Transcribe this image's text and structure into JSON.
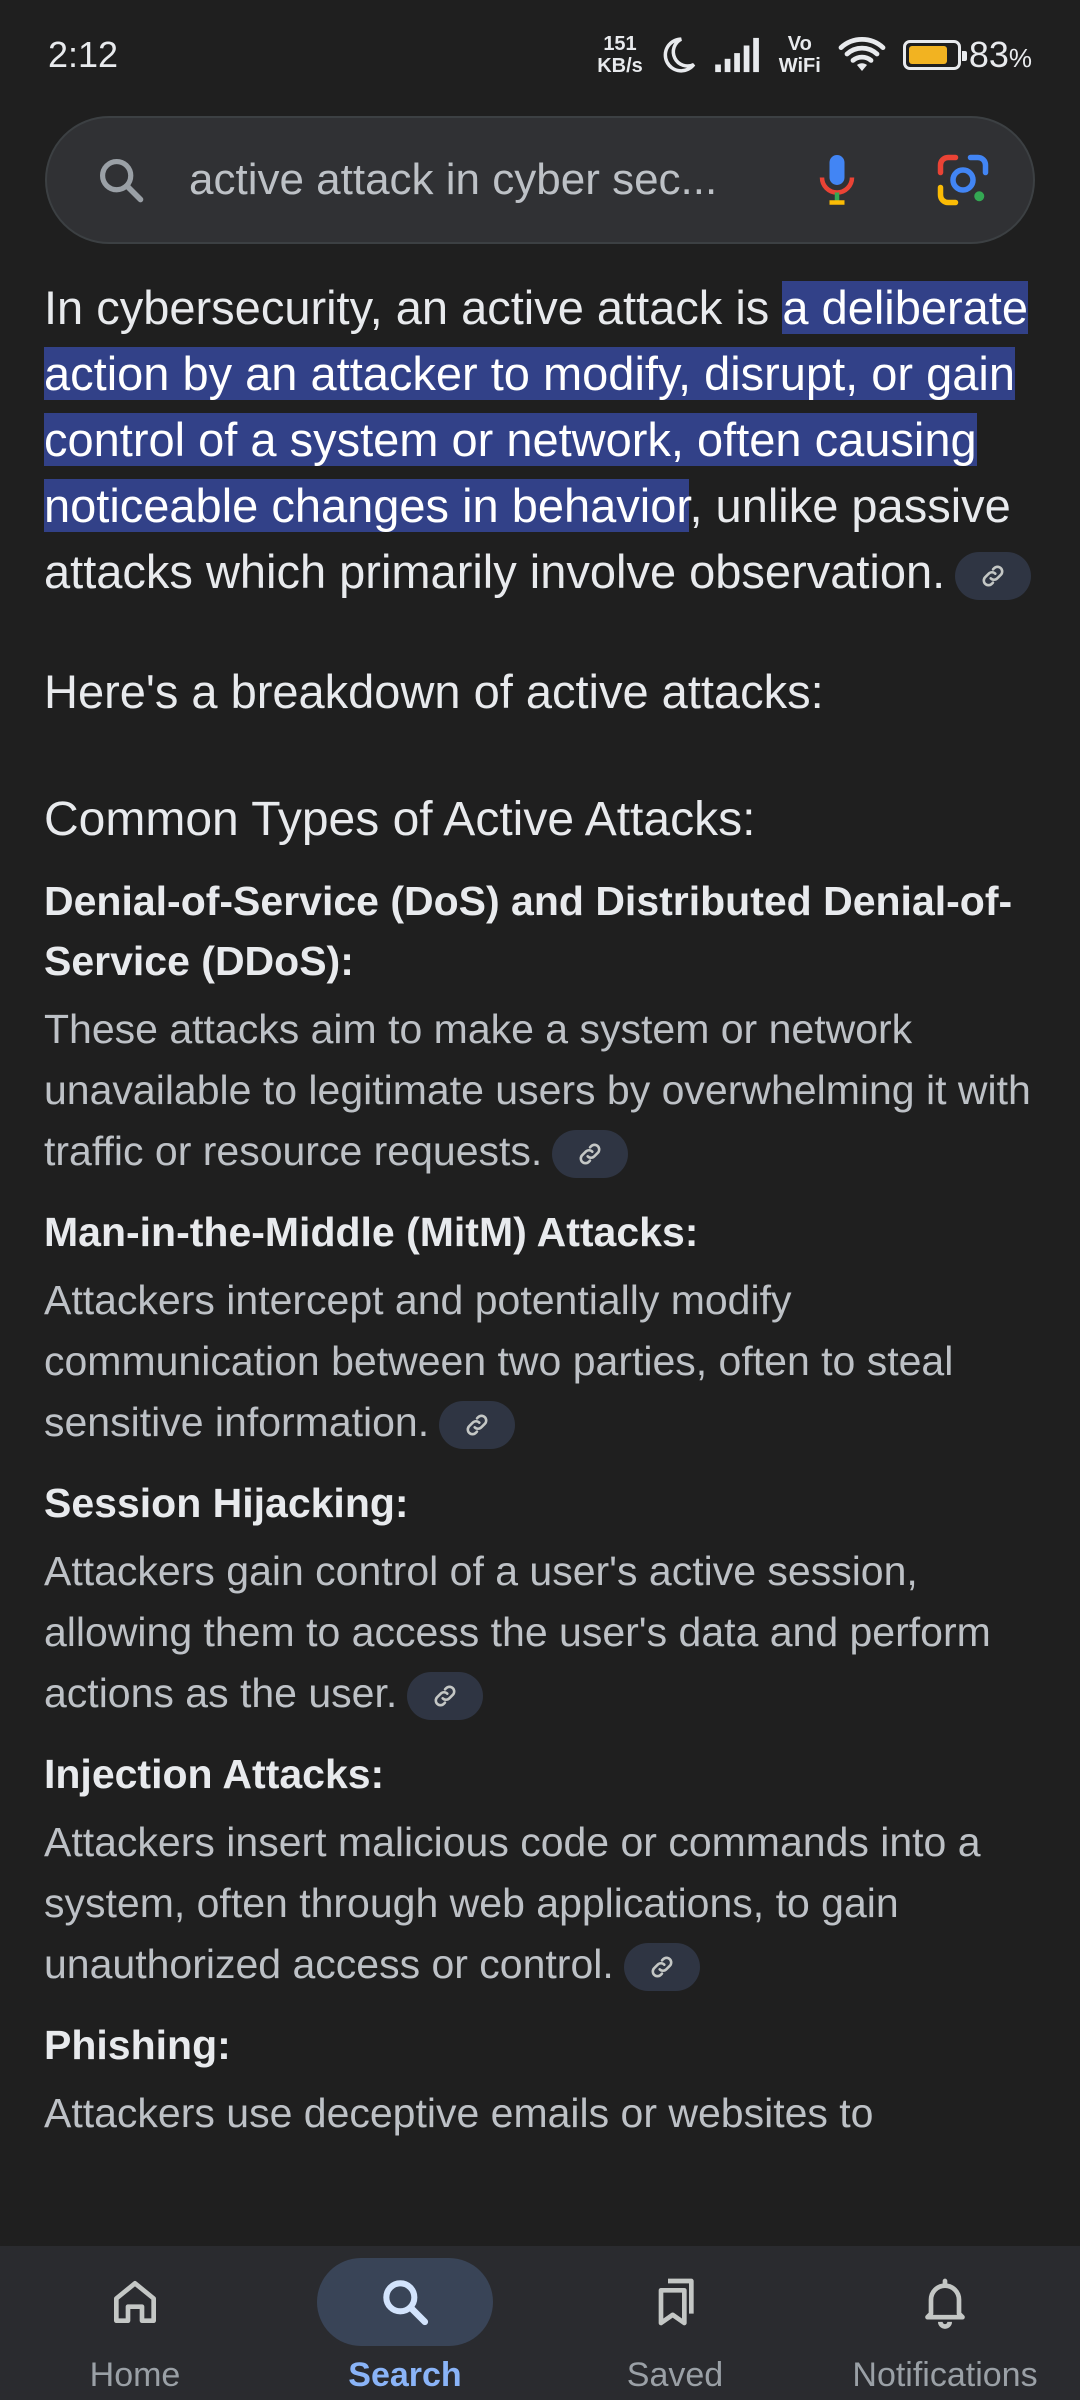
{
  "status_bar": {
    "time": "2:12",
    "net_speed_value": "151",
    "net_speed_unit": "KB/s",
    "volte_top": "Vo",
    "volte_bottom": "WiFi",
    "battery_percent": "83",
    "battery_percent_sign": "%",
    "battery_level": 0.83
  },
  "search": {
    "query": "active attack in cyber sec..."
  },
  "content": {
    "intro_before": "In cybersecurity, an active attack is ",
    "intro_highlight": "a deliberate action by an attacker to modify, disrupt, or gain control of a system or network, often causing noticeable changes in behavior",
    "intro_after": ", unlike passive attacks which primarily involve observation.",
    "breakdown": "Here's a breakdown of active attacks:",
    "section_heading": "Common Types of Active Attacks:",
    "items": [
      {
        "title": "Denial-of-Service (DoS) and Distributed Denial-of-Service (DDoS):",
        "body": "These attacks aim to make a system or network unavailable to legitimate users by overwhelming it with traffic or resource requests."
      },
      {
        "title": "Man-in-the-Middle (MitM) Attacks:",
        "body": "Attackers intercept and potentially modify communication between two parties, often to steal sensitive information."
      },
      {
        "title": "Session Hijacking:",
        "body": "Attackers gain control of a user's active session, allowing them to access the user's data and perform actions as the user."
      },
      {
        "title": "Injection Attacks:",
        "body": "Attackers insert malicious code or commands into a system, often through web applications, to gain unauthorized access or control."
      },
      {
        "title": "Phishing:",
        "body": "Attackers use deceptive emails or websites to"
      }
    ]
  },
  "bottom_nav": {
    "items": [
      {
        "label": "Home",
        "icon": "home-icon"
      },
      {
        "label": "Search",
        "icon": "search-icon"
      },
      {
        "label": "Saved",
        "icon": "bookmarks-icon"
      },
      {
        "label": "Notifications",
        "icon": "bell-icon"
      }
    ],
    "active": "Search"
  },
  "colors": {
    "background": "#1f1f1f",
    "highlight": "#324188",
    "accent": "#8ab4f8",
    "nav_bg": "#2a2b2f"
  }
}
